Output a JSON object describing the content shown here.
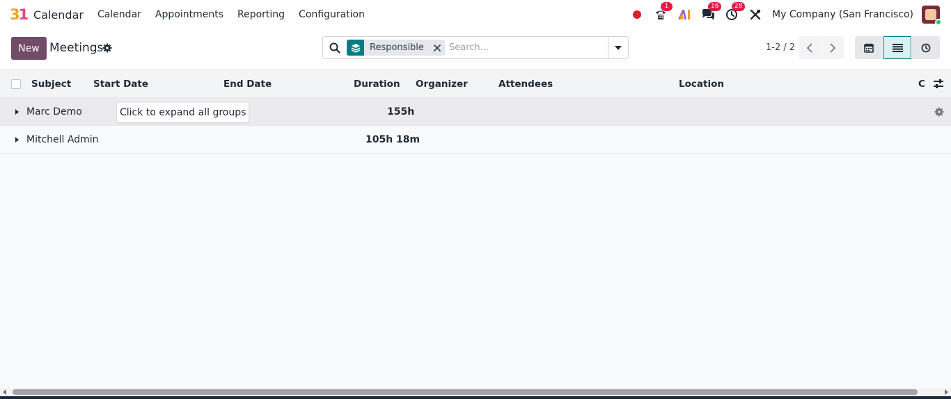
{
  "navbar": {
    "app_name": "Calendar",
    "logo_text": "31",
    "menu": [
      "Calendar",
      "Appointments",
      "Reporting",
      "Configuration"
    ],
    "badges": {
      "phone": "1",
      "chat": "16",
      "activity": "28"
    },
    "company": "My Company (San Francisco)"
  },
  "control": {
    "new_label": "New",
    "title": "Meetings",
    "facet_label": "Responsible",
    "search_placeholder": "Search...",
    "pager": "1-2 / 2"
  },
  "columns": [
    "Subject",
    "Start Date",
    "End Date",
    "Duration",
    "Organizer",
    "Attendees",
    "Location",
    "C"
  ],
  "groups": [
    {
      "name": "Marc Demo",
      "total": "155h"
    },
    {
      "name": "Mitchell Admin",
      "total": "105h 18m"
    }
  ],
  "tooltip": "Click to expand all groups",
  "colors": {
    "primary": "#714b67",
    "accent": "#017e84",
    "badge": "#e11d48"
  }
}
